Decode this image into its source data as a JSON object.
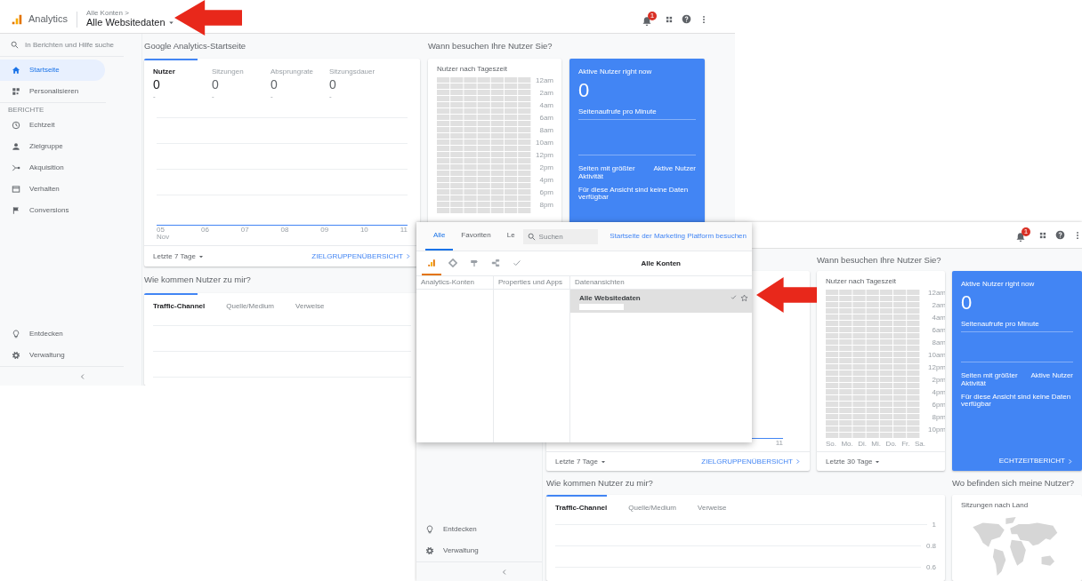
{
  "window_a": {
    "top_bar": {
      "product": "Analytics",
      "breadcrumb": "Alle Konten >",
      "view_selector": "Alle Websitedaten",
      "notification_count": "1"
    },
    "sidebar": {
      "search_placeholder": "In Berichten und Hilfe suche",
      "items": [
        {
          "label": "Startseite",
          "selected": true
        },
        {
          "label": "Personalisieren",
          "selected": false
        }
      ],
      "section_label": "BERICHTE",
      "reports": [
        {
          "label": "Echtzeit",
          "selected": false
        },
        {
          "label": "Zielgruppe",
          "selected": false
        },
        {
          "label": "Akquisition",
          "selected": false
        },
        {
          "label": "Verhalten",
          "selected": false
        },
        {
          "label": "Conversions",
          "selected": false
        }
      ],
      "footer_items": [
        {
          "label": "Entdecken"
        },
        {
          "label": "Verwaltung"
        }
      ]
    },
    "home_title": "Google Analytics-Startseite",
    "overview": {
      "metrics": [
        {
          "label": "Nutzer",
          "value": "0",
          "change": "-",
          "selected": true
        },
        {
          "label": "Sitzungen",
          "value": "0",
          "change": "-",
          "selected": false
        },
        {
          "label": "Absprungrate",
          "value": "0",
          "change": "-",
          "selected": false
        },
        {
          "label": "Sitzungsdauer",
          "value": "0",
          "change": "-",
          "selected": false
        }
      ],
      "x_ticks": [
        {
          "label": "05",
          "sub": "Nov"
        },
        {
          "label": "06"
        },
        {
          "label": "07"
        },
        {
          "label": "08"
        },
        {
          "label": "09"
        },
        {
          "label": "10"
        },
        {
          "label": "11"
        }
      ],
      "date_range": "Letzte 7 Tage",
      "link": "ZIELGRUPPENÜBERSICHT"
    },
    "when_title": "Wann besuchen Ihre Nutzer Sie?",
    "heatmap": {
      "title": "Nutzer nach Tageszeit",
      "hours": [
        "12am",
        "2am",
        "4am",
        "6am",
        "8am",
        "10am",
        "12pm",
        "2pm",
        "4pm",
        "6pm",
        "8pm"
      ]
    },
    "realtime": {
      "title": "Aktive Nutzer right now",
      "value": "0",
      "subtitle": "Seitenaufrufe pro Minute",
      "pages_label": "Seiten mit größter Aktivität",
      "users_label": "Aktive Nutzer",
      "empty_message": "Für diese Ansicht sind keine Daten verfügbar"
    },
    "acquisition": {
      "title": "Wie kommen Nutzer zu mir?",
      "tabs": [
        {
          "label": "Traffic-Channel",
          "selected": true
        },
        {
          "label": "Quelle/Medium",
          "selected": false
        },
        {
          "label": "Verweise",
          "selected": false
        }
      ]
    }
  },
  "window_b": {
    "top_bar": {
      "notification_count": "1"
    },
    "sidebar": {
      "footer_items": [
        {
          "label": "Entdecken"
        },
        {
          "label": "Verwaltung"
        }
      ]
    },
    "overview": {
      "x_ticks": [
        {
          "label": "11"
        }
      ],
      "date_range": "Letzte 7 Tage",
      "link": "ZIELGRUPPENÜBERSICHT"
    },
    "when_title": "Wann besuchen Ihre Nutzer Sie?",
    "heatmap": {
      "title": "Nutzer nach Tageszeit",
      "hours": [
        "12am",
        "2am",
        "4am",
        "6am",
        "8am",
        "10am",
        "12pm",
        "2pm",
        "4pm",
        "6pm",
        "8pm",
        "10pm"
      ],
      "days": [
        "So.",
        "Mo.",
        "Di.",
        "Mi.",
        "Do.",
        "Fr.",
        "Sa."
      ],
      "date_range": "Letzte 30 Tage"
    },
    "realtime": {
      "title": "Aktive Nutzer right now",
      "value": "0",
      "subtitle": "Seitenaufrufe pro Minute",
      "pages_label": "Seiten mit größter Aktivität",
      "users_label": "Aktive Nutzer",
      "empty_message": "Für diese Ansicht sind keine Daten verfügbar",
      "link": "ECHTZEITBERICHT"
    },
    "acquisition": {
      "title": "Wie kommen Nutzer zu mir?",
      "tabs": [
        {
          "label": "Traffic-Channel",
          "selected": true
        },
        {
          "label": "Quelle/Medium",
          "selected": false
        },
        {
          "label": "Verweise",
          "selected": false
        }
      ],
      "y_ticks": [
        "1",
        "0.8",
        "0.6"
      ]
    },
    "location": {
      "title": "Wo befinden sich meine Nutzer?",
      "card_title": "Sitzungen nach Land"
    }
  },
  "account_picker": {
    "tabs": [
      {
        "label": "Alle",
        "selected": true
      },
      {
        "label": "Favoriten",
        "selected": false
      },
      {
        "label": "Le",
        "selected": false
      }
    ],
    "search_placeholder": "Suchen",
    "platform_link": "Startseite der Marketing Platform besuchen",
    "icon_tabs": [
      {
        "selected": true
      },
      {
        "selected": false
      },
      {
        "selected": false
      },
      {
        "selected": false
      },
      {
        "selected": false
      }
    ],
    "scope_title": "Alle Konten",
    "columns": [
      "Analytics-Konten",
      "Properties und Apps",
      "Datenansichten"
    ],
    "views": [
      {
        "label": "Alle Websitedaten",
        "selected": true
      }
    ]
  }
}
